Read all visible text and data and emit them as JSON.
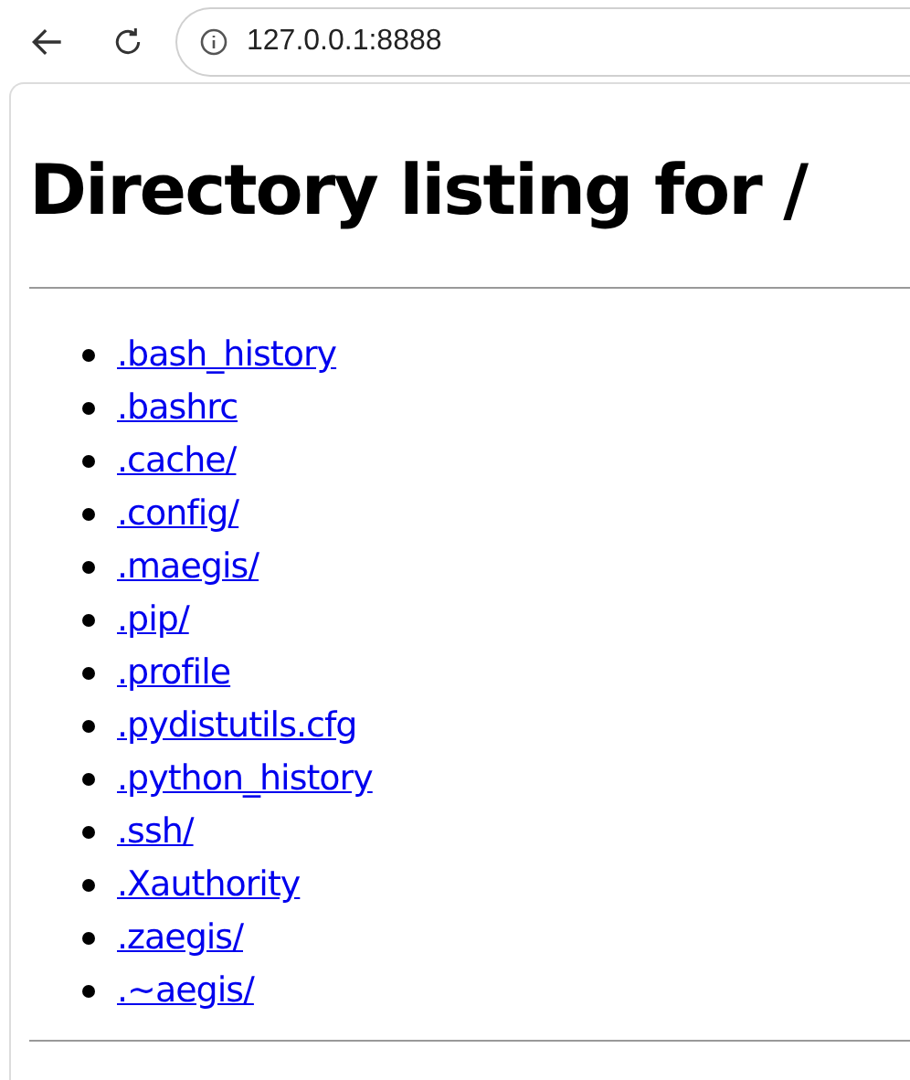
{
  "address_bar": {
    "url": "127.0.0.1:8888"
  },
  "page": {
    "heading": "Directory listing for /",
    "links": [
      ".bash_history",
      ".bashrc",
      ".cache/",
      ".config/",
      ".maegis/",
      ".pip/",
      ".profile",
      ".pydistutils.cfg",
      ".python_history",
      ".ssh/",
      ".Xauthority",
      ".zaegis/",
      ".~aegis/"
    ]
  }
}
